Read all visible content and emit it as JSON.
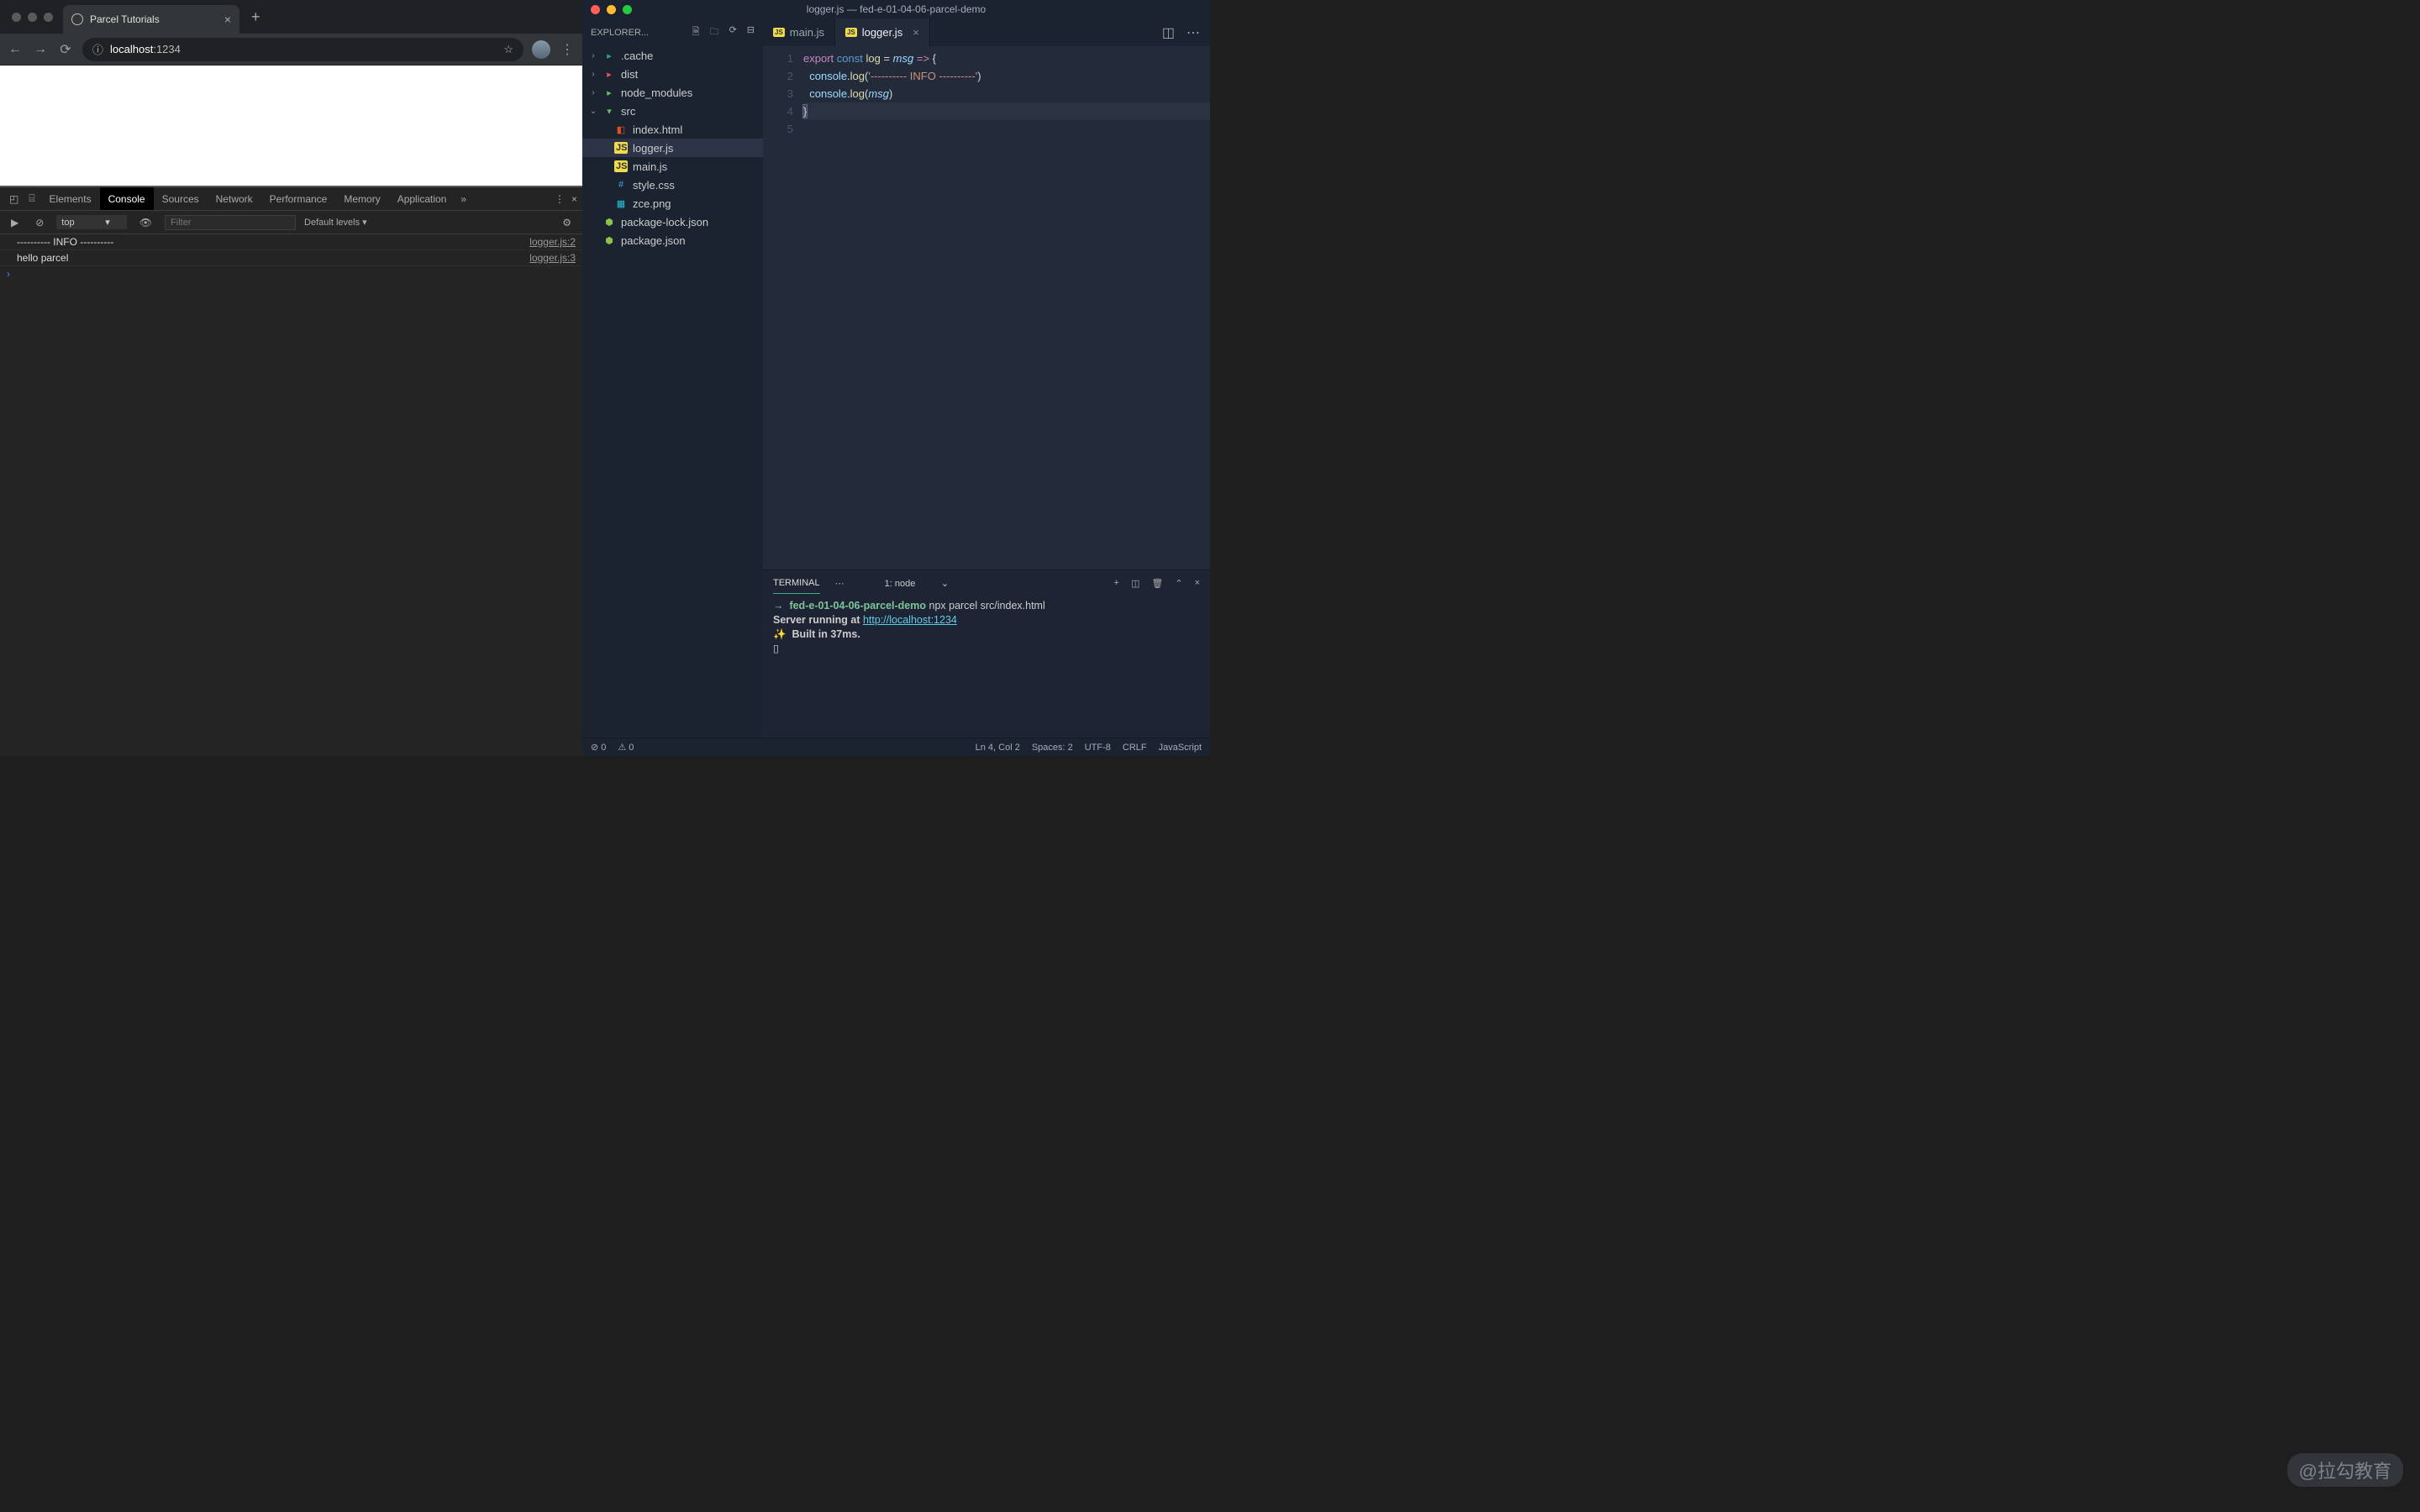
{
  "browser": {
    "tab_title": "Parcel Tutorials",
    "url_prefix": "localhost",
    "url_port": ":1234"
  },
  "devtools": {
    "tabs": [
      "Elements",
      "Console",
      "Sources",
      "Network",
      "Performance",
      "Memory",
      "Application"
    ],
    "active_tab": "Console",
    "context": "top",
    "filter_placeholder": "Filter",
    "levels": "Default levels ▾",
    "rows": [
      {
        "msg": "---------- INFO ----------",
        "src": "logger.js:2"
      },
      {
        "msg": "hello parcel",
        "src": "logger.js:3"
      }
    ]
  },
  "vscode": {
    "title": "logger.js — fed-e-01-04-06-parcel-demo",
    "explorer_label": "EXPLORER...",
    "tree": [
      {
        "kind": "folder",
        "name": ".cache",
        "depth": 0,
        "chev": "›",
        "icon": "ic-folder-teal",
        "glyph": "▸"
      },
      {
        "kind": "folder",
        "name": "dist",
        "depth": 0,
        "chev": "›",
        "icon": "ic-folder-red",
        "glyph": "▸"
      },
      {
        "kind": "folder",
        "name": "node_modules",
        "depth": 0,
        "chev": "›",
        "icon": "ic-folder-green",
        "glyph": "▸"
      },
      {
        "kind": "folder",
        "name": "src",
        "depth": 0,
        "chev": "⌄",
        "icon": "ic-folder-green",
        "glyph": "▾",
        "open": true
      },
      {
        "kind": "file",
        "name": "index.html",
        "depth": 1,
        "icon": "ic-html",
        "glyph": "◧"
      },
      {
        "kind": "file",
        "name": "logger.js",
        "depth": 1,
        "icon": "ic-js",
        "glyph": "JS",
        "sel": true
      },
      {
        "kind": "file",
        "name": "main.js",
        "depth": 1,
        "icon": "ic-js",
        "glyph": "JS"
      },
      {
        "kind": "file",
        "name": "style.css",
        "depth": 1,
        "icon": "ic-css",
        "glyph": "#"
      },
      {
        "kind": "file",
        "name": "zce.png",
        "depth": 1,
        "icon": "ic-img",
        "glyph": "▦"
      },
      {
        "kind": "file",
        "name": "package-lock.json",
        "depth": 0,
        "icon": "ic-json",
        "glyph": "⬢"
      },
      {
        "kind": "file",
        "name": "package.json",
        "depth": 0,
        "icon": "ic-json",
        "glyph": "⬢"
      }
    ],
    "editor_tabs": [
      {
        "name": "main.js",
        "active": false
      },
      {
        "name": "logger.js",
        "active": true
      }
    ],
    "code_lines": [
      {
        "n": 1,
        "html": "<span class='kw'>export</span> <span class='kw2'>const</span> <span class='fn'>log</span> <span class='pun'>=</span> <span class='param'>msg</span> <span class='op'>=&gt;</span> <span class='pun'>{</span>"
      },
      {
        "n": 2,
        "html": "  <span class='var'>console</span><span class='pun'>.</span><span class='fn'>log</span><span class='pun'>(</span><span class='str'>'---------- INFO ----------'</span><span class='pun'>)</span>"
      },
      {
        "n": 3,
        "html": "  <span class='var'>console</span><span class='pun'>.</span><span class='fn'>log</span><span class='pun'>(</span><span class='param'>msg</span><span class='pun'>)</span>"
      },
      {
        "n": 4,
        "html": "<span class='pun brace'>}</span>",
        "cur": true
      },
      {
        "n": 5,
        "html": ""
      }
    ],
    "terminal": {
      "label": "TERMINAL",
      "selector": "1: node",
      "lines": [
        {
          "html": "<span class='t-green'>→  fed-e-01-04-06-parcel-demo</span> npx parcel src/index.html"
        },
        {
          "html": "<b>Server running at</b> <span class='t-url'>http://localhost:1234</span>"
        },
        {
          "html": "<span class='t-spark'>✨</span>  <b>Built in 37ms.</b>"
        },
        {
          "html": "▯"
        }
      ]
    },
    "status": {
      "errors": "⊘ 0",
      "warnings": "⚠ 0",
      "pos": "Ln 4, Col 2",
      "spaces": "Spaces: 2",
      "enc": "UTF-8",
      "eol": "CRLF",
      "lang": "JavaScript"
    }
  },
  "watermark": "@拉勾教育"
}
